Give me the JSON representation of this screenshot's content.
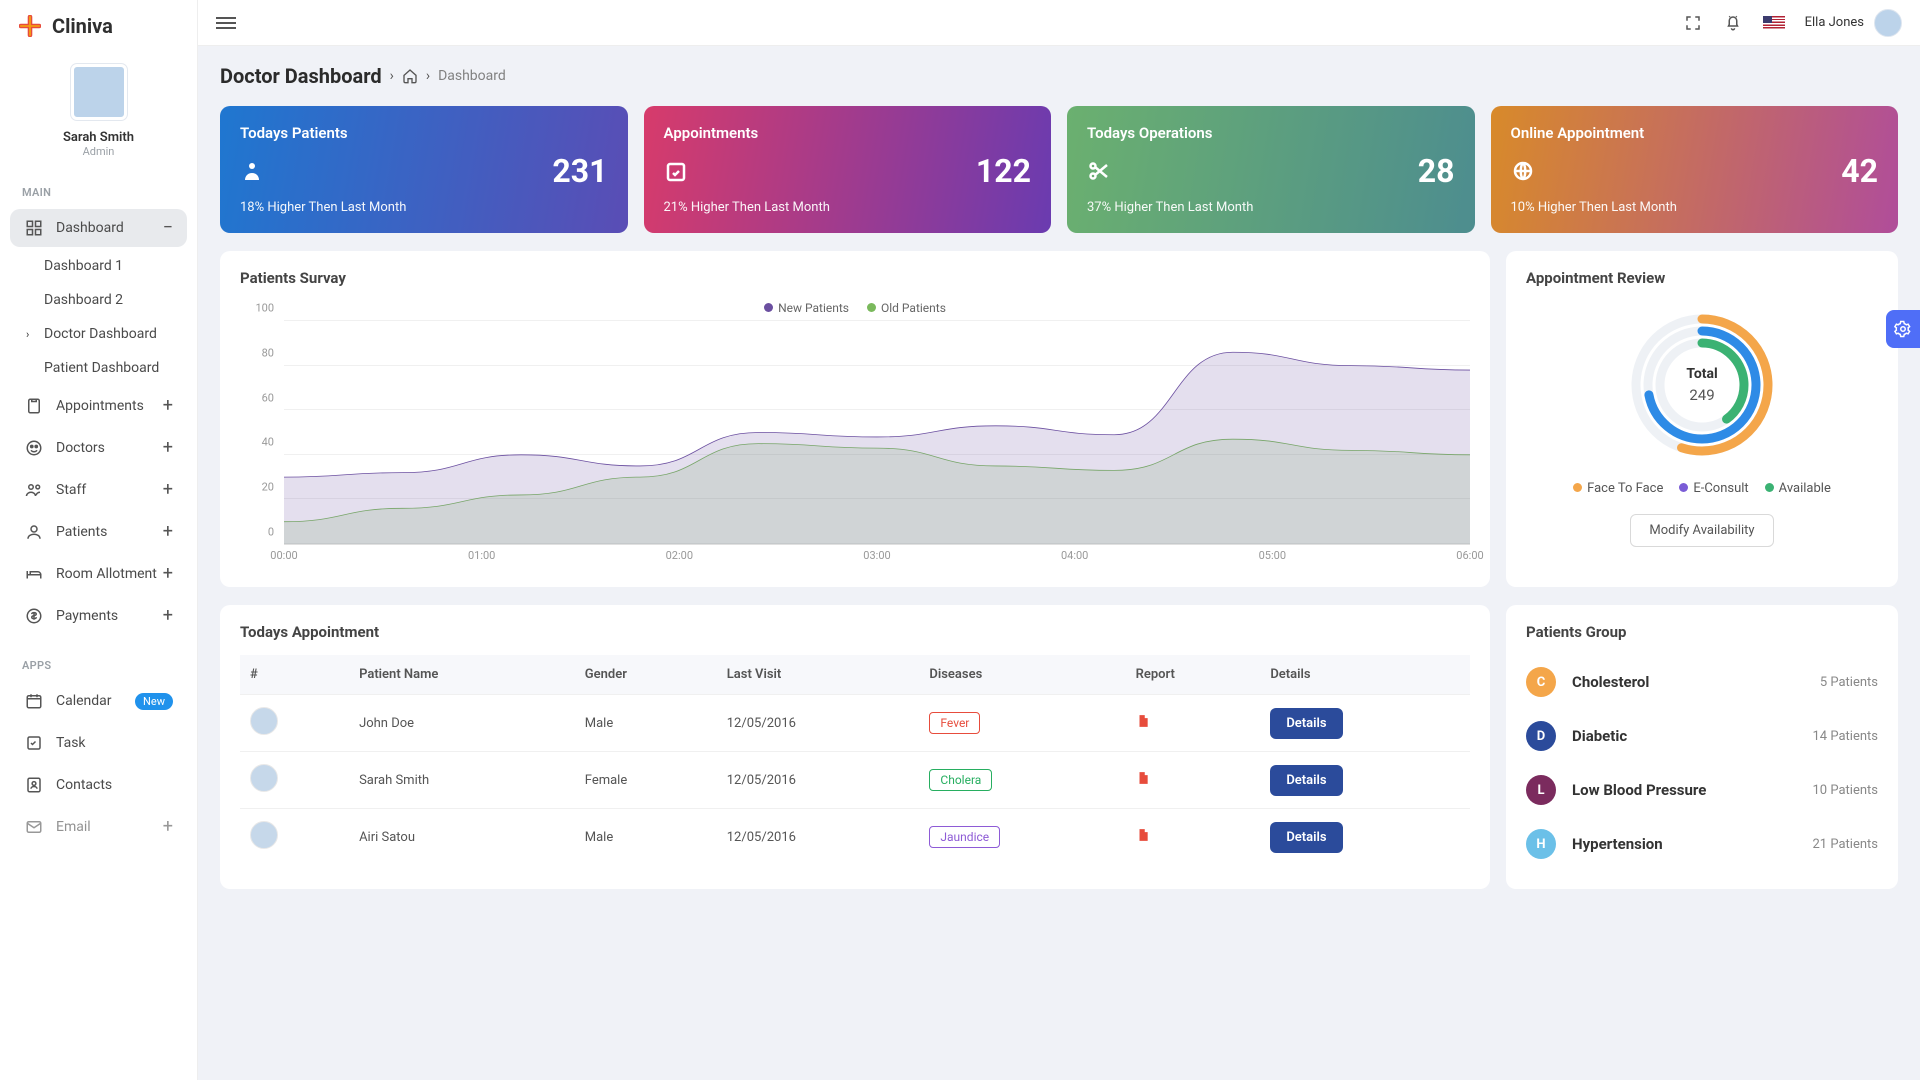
{
  "brand": "Cliniva",
  "user": {
    "name": "Sarah Smith",
    "role": "Admin"
  },
  "topbar": {
    "username": "Ella Jones"
  },
  "nav": {
    "section_main": "MAIN",
    "section_apps": "APPS",
    "dashboard": "Dashboard",
    "dashboard1": "Dashboard 1",
    "dashboard2": "Dashboard 2",
    "doctor_dashboard": "Doctor Dashboard",
    "patient_dashboard": "Patient Dashboard",
    "appointments": "Appointments",
    "doctors": "Doctors",
    "staff": "Staff",
    "patients": "Patients",
    "room": "Room Allotment",
    "payments": "Payments",
    "calendar": "Calendar",
    "calendar_badge": "New",
    "task": "Task",
    "contacts": "Contacts",
    "email": "Email"
  },
  "header": {
    "title": "Doctor Dashboard",
    "crumb": "Dashboard"
  },
  "stats": [
    {
      "title": "Todays Patients",
      "value": "231",
      "sub": "18% Higher Then Last Month"
    },
    {
      "title": "Appointments",
      "value": "122",
      "sub": "21% Higher Then Last Month"
    },
    {
      "title": "Todays Operations",
      "value": "28",
      "sub": "37% Higher Then Last Month"
    },
    {
      "title": "Online Appointment",
      "value": "42",
      "sub": "10% Higher Then Last Month"
    }
  ],
  "survey": {
    "title": "Patients Survay",
    "legend": {
      "new": "New Patients",
      "old": "Old Patients"
    }
  },
  "review": {
    "title": "Appointment Review",
    "total_label": "Total",
    "total_value": "249",
    "legend": {
      "f2f": "Face To Face",
      "econ": "E-Consult",
      "avail": "Available"
    },
    "button": "Modify Availability"
  },
  "appointments": {
    "title": "Todays Appointment",
    "columns": {
      "idx": "#",
      "name": "Patient Name",
      "gender": "Gender",
      "last": "Last Visit",
      "disease": "Diseases",
      "report": "Report",
      "details": "Details"
    },
    "rows": [
      {
        "name": "John Doe",
        "gender": "Male",
        "last": "12/05/2016",
        "disease": "Fever",
        "pill": "red"
      },
      {
        "name": "Sarah Smith",
        "gender": "Female",
        "last": "12/05/2016",
        "disease": "Cholera",
        "pill": "green"
      },
      {
        "name": "Airi Satou",
        "gender": "Male",
        "last": "12/05/2016",
        "disease": "Jaundice",
        "pill": "purple"
      }
    ],
    "details_btn": "Details"
  },
  "groups": {
    "title": "Patients Group",
    "items": [
      {
        "letter": "C",
        "name": "Cholesterol",
        "count": "5 Patients",
        "color": "#f4a64a"
      },
      {
        "letter": "D",
        "name": "Diabetic",
        "count": "14 Patients",
        "color": "#2b4b9b"
      },
      {
        "letter": "L",
        "name": "Low Blood Pressure",
        "count": "10 Patients",
        "color": "#7b2b5e"
      },
      {
        "letter": "H",
        "name": "Hypertension",
        "count": "21 Patients",
        "color": "#6bc0e8"
      }
    ]
  },
  "chart_data": {
    "type": "area",
    "x": [
      "00:00",
      "01:00",
      "02:00",
      "03:00",
      "04:00",
      "05:00",
      "06:00"
    ],
    "ylim": [
      0,
      100
    ],
    "yticks": [
      0,
      20,
      40,
      60,
      80,
      100
    ],
    "series": [
      {
        "name": "New Patients",
        "color": "#6b4fa0",
        "values": [
          30,
          32,
          40,
          35,
          50,
          48,
          53,
          49,
          86,
          80,
          78
        ]
      },
      {
        "name": "Old Patients",
        "color": "#7ab95c",
        "values": [
          10,
          16,
          22,
          30,
          45,
          43,
          35,
          33,
          47,
          42,
          40
        ]
      }
    ],
    "donut": {
      "total": 249,
      "series": [
        {
          "name": "Face To Face",
          "color": "#f4a64a",
          "fraction": 0.55
        },
        {
          "name": "E-Consult",
          "color": "#2e8be6",
          "fraction": 0.72
        },
        {
          "name": "Available",
          "color": "#3bb273",
          "fraction": 0.4
        }
      ]
    }
  }
}
